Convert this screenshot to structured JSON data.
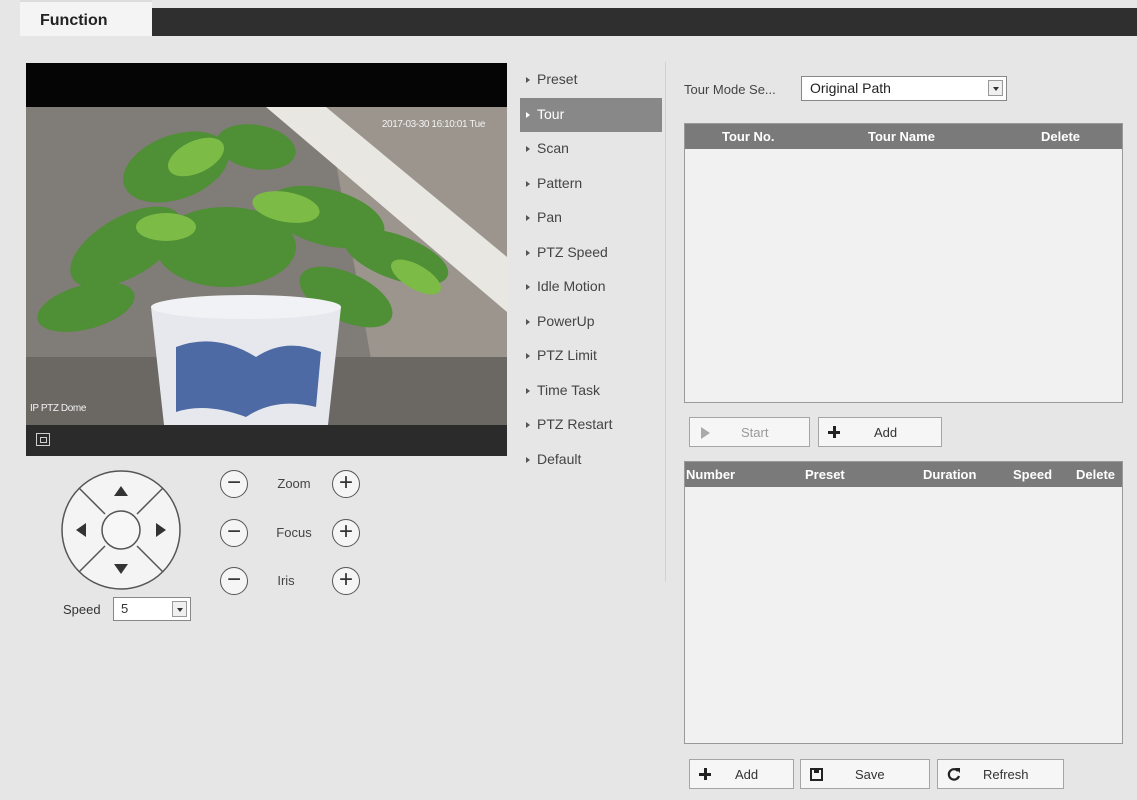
{
  "tabs": {
    "function_label": "Function"
  },
  "video": {
    "timestamp": "2017-03-30 16:10:01 Tue",
    "channel_name": "IP PTZ Dome"
  },
  "ptz": {
    "zoom_label": "Zoom",
    "focus_label": "Focus",
    "iris_label": "Iris",
    "minus_glyph": "−",
    "plus_glyph": "+",
    "speed_label": "Speed",
    "speed_value": "5"
  },
  "menu": {
    "items": [
      {
        "label": "Preset"
      },
      {
        "label": "Tour"
      },
      {
        "label": "Scan"
      },
      {
        "label": "Pattern"
      },
      {
        "label": "Pan"
      },
      {
        "label": "PTZ Speed"
      },
      {
        "label": "Idle Motion"
      },
      {
        "label": "PowerUp"
      },
      {
        "label": "PTZ Limit"
      },
      {
        "label": "Time Task"
      },
      {
        "label": "PTZ Restart"
      },
      {
        "label": "Default"
      }
    ],
    "active_index": 1
  },
  "tour": {
    "mode_label": "Tour Mode Se...",
    "mode_value": "Original Path",
    "columns": [
      "Tour No.",
      "Tour Name",
      "Delete"
    ],
    "start_label": "Start",
    "add_label": "Add"
  },
  "steps": {
    "columns": [
      "Number",
      "Preset",
      "Duration",
      "Speed",
      "Delete"
    ],
    "add_label": "Add",
    "save_label": "Save",
    "refresh_label": "Refresh"
  },
  "colors": {
    "header_bar": "#2f2f2f",
    "active_menu": "#888888",
    "table_header": "#7a7a7a"
  }
}
